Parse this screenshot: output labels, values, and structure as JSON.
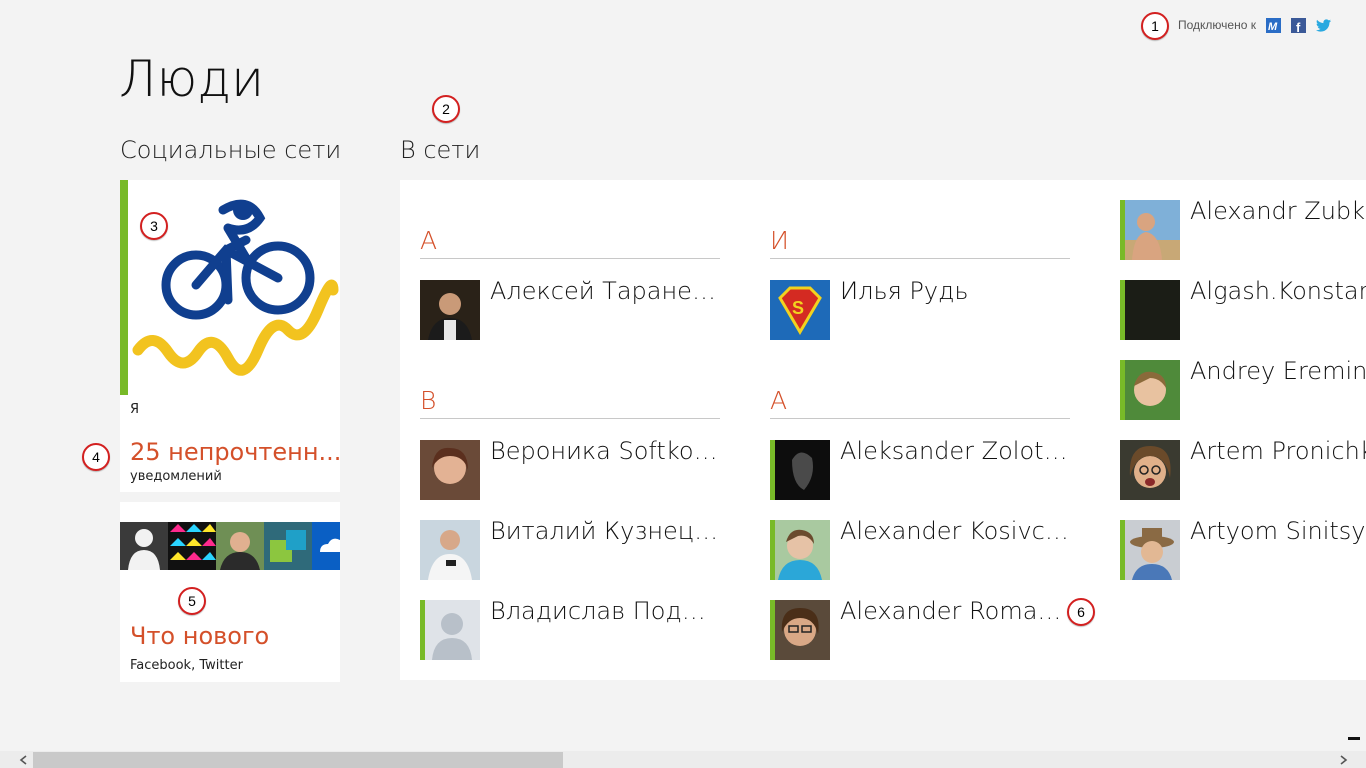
{
  "header": {
    "connected_label": "Подключено к",
    "services": [
      {
        "name": "outlook",
        "color": "#2a6dc6"
      },
      {
        "name": "facebook",
        "color": "#3b5998"
      },
      {
        "name": "twitter",
        "color": "#2aa9e0"
      }
    ]
  },
  "page": {
    "title": "Люди"
  },
  "sections": {
    "social": "Социальные сети",
    "online": "В сети"
  },
  "me_tile": {
    "label": "Я",
    "notifications": "25 непрочтенн...",
    "notifications_sub": "уведомлений"
  },
  "whats_new": {
    "title": "Что нового",
    "sources": "Facebook, Twitter"
  },
  "groups": [
    {
      "letter": "А"
    },
    {
      "letter": "В"
    },
    {
      "letter": "И"
    },
    {
      "letter": "A"
    }
  ],
  "contacts": {
    "group_a_cyr": [
      "Алексей Тараненко"
    ],
    "group_v_cyr": [
      "Вероника Softkova",
      "Виталий Кузнецов",
      "Владислав Подберёзкин"
    ],
    "group_i_cyr": [
      "Илья Рудь"
    ],
    "group_a_lat": [
      "Aleksander Zolotov",
      "Alexander Kosivchenko",
      "Alexander Romanov"
    ],
    "col3": [
      "Alexandr Zubkov",
      "Algash.Konstantin",
      "Andrey Eremin",
      "Artem Pronichkin",
      "Artyom Sinitsyn"
    ]
  },
  "callouts": [
    "1",
    "2",
    "3",
    "4",
    "5",
    "6"
  ],
  "colors": {
    "accent_green": "#78ba28",
    "accent_orange": "#d4502a",
    "onedrive_blue": "#0a5fc4"
  }
}
